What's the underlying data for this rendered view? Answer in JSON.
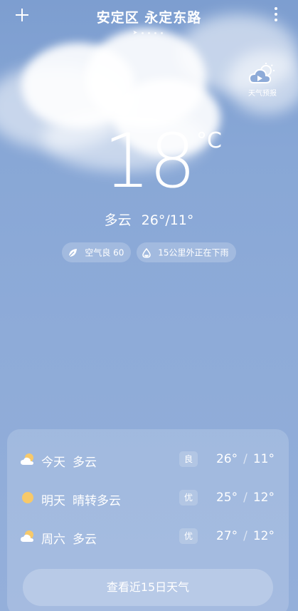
{
  "header": {
    "location": "安定区 永定东路",
    "page_count": 5
  },
  "forecast_button": {
    "label": "天气预报",
    "icon": "cloud-sun-play-icon"
  },
  "current": {
    "temperature": "18",
    "unit": "°C",
    "condition": "多云",
    "range": "26°/11°"
  },
  "chips": [
    {
      "icon": "leaf-icon",
      "text": "空气良 60"
    },
    {
      "icon": "raindrop-icon",
      "text": "15公里外正在下雨"
    }
  ],
  "daily": [
    {
      "icon": "partly-cloudy-icon",
      "day": "今天",
      "condition": "多云",
      "aqi": "良",
      "high": "26°",
      "low": "11°"
    },
    {
      "icon": "sun-icon",
      "day": "明天",
      "condition": "晴转多云",
      "aqi": "优",
      "high": "25°",
      "low": "12°"
    },
    {
      "icon": "partly-cloudy-icon",
      "day": "周六",
      "condition": "多云",
      "aqi": "优",
      "high": "27°",
      "low": "12°"
    }
  ],
  "temp_separator": "/",
  "more_button": {
    "label": "查看近15日天气"
  },
  "colors": {
    "background": "#88a7d6",
    "sun": "#f7c96a",
    "text": "#ffffff"
  }
}
